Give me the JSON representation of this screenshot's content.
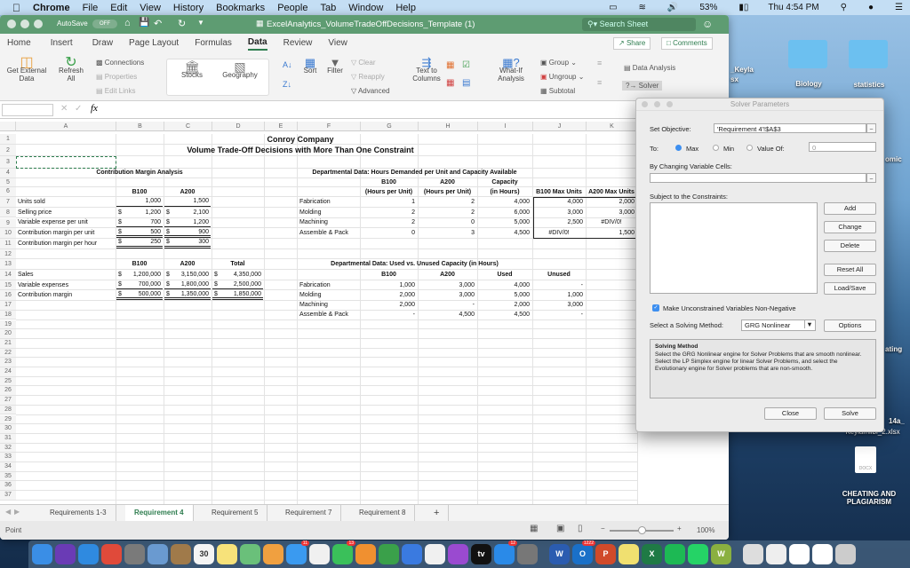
{
  "menubar": {
    "apple": "",
    "app": "Chrome",
    "items": [
      "File",
      "Edit",
      "View",
      "History",
      "Bookmarks",
      "People",
      "Tab",
      "Window",
      "Help"
    ],
    "battery": "53%",
    "clock": "Thu 4:54 PM"
  },
  "excel": {
    "autosave": "AutoSave",
    "autosave_state": "OFF",
    "title": "ExcelAnalytics_VolumeTradeOffDecisions_Template (1)",
    "search_placeholder": "Search Sheet",
    "tabs": [
      "Home",
      "Insert",
      "Draw",
      "Page Layout",
      "Formulas",
      "Data",
      "Review",
      "View"
    ],
    "active_tab": "Data",
    "share": "Share",
    "comments": "Comments",
    "ribbon": {
      "get_external": "Get External Data",
      "refresh_all": "Refresh All",
      "connections": "Connections",
      "properties": "Properties",
      "edit_links": "Edit Links",
      "stocks": "Stocks",
      "geography": "Geography",
      "sort": "Sort",
      "filter": "Filter",
      "clear": "Clear",
      "reapply": "Reapply",
      "advanced": "Advanced",
      "text_to_columns": "Text to Columns",
      "what_if": "What-If Analysis",
      "group": "Group",
      "ungroup": "Ungroup",
      "subtotal": "Subtotal",
      "data_analysis": "Data Analysis",
      "solver": "Solver"
    },
    "formula_bar": {
      "name_box": "",
      "fx": "fx",
      "formula": ""
    },
    "columns": [
      "A",
      "B",
      "C",
      "D",
      "E",
      "F",
      "G",
      "H",
      "I",
      "J",
      "K"
    ],
    "cells": {
      "1": {
        "A": "Conroy Company"
      },
      "2": {
        "A": "Volume Trade-Off Decisions with More Than One Constraint"
      },
      "4": {
        "A": "Contribution Margin Analysis",
        "F": "Departmental Data: Hours Demanded per Unit and Capacity Available"
      },
      "5": {
        "G": "B100",
        "H": "A200",
        "I": "Capacity"
      },
      "6": {
        "B": "B100",
        "C": "A200",
        "G": "(Hours per Unit)",
        "H": "(Hours per Unit)",
        "I": "(in Hours)",
        "J": "B100 Max Units",
        "K": "A200 Max Units"
      },
      "7": {
        "A": "Units sold",
        "B": "1,000",
        "C": "1,500",
        "F": "Fabrication",
        "G": "1",
        "H": "2",
        "I": "4,000",
        "J": "4,000",
        "K": "2,000"
      },
      "8": {
        "A": "Selling price",
        "B": {
          "sym": "$",
          "v": "1,200"
        },
        "C": {
          "sym": "$",
          "v": "2,100"
        },
        "F": "Molding",
        "G": "2",
        "H": "2",
        "I": "6,000",
        "J": "3,000",
        "K": "3,000"
      },
      "9": {
        "A": "Variable expense per unit",
        "B": {
          "sym": "$",
          "v": "700"
        },
        "C": {
          "sym": "$",
          "v": "1,200"
        },
        "F": "Machining",
        "G": "2",
        "H": "0",
        "I": "5,000",
        "J": "2,500",
        "K": "#DIV/0!"
      },
      "10": {
        "A": "Contribution margin per unit",
        "B": {
          "sym": "$",
          "v": "500"
        },
        "C": {
          "sym": "$",
          "v": "900"
        },
        "F": "Assemble & Pack",
        "G": "0",
        "H": "3",
        "I": "4,500",
        "J": "#DIV/0!",
        "K": "1,500"
      },
      "11": {
        "A": "Contribution margin per hour",
        "B": {
          "sym": "$",
          "v": "250"
        },
        "C": {
          "sym": "$",
          "v": "300"
        }
      },
      "13": {
        "B": "B100",
        "C": "A200",
        "D": "Total",
        "F": "Departmental Data: Used vs. Unused Capacity (in Hours)"
      },
      "14": {
        "A": "Sales",
        "B": {
          "sym": "$",
          "v": "1,200,000"
        },
        "C": {
          "sym": "$",
          "v": "3,150,000"
        },
        "D": {
          "sym": "$",
          "v": "4,350,000"
        },
        "G": "B100",
        "H": "A200",
        "I": "Used",
        "J": "Unused"
      },
      "15": {
        "A": "Variable expenses",
        "B": {
          "sym": "$",
          "v": "700,000"
        },
        "C": {
          "sym": "$",
          "v": "1,800,000"
        },
        "D": {
          "sym": "$",
          "v": "2,500,000"
        },
        "F": "Fabrication",
        "G": "1,000",
        "H": "3,000",
        "I": "4,000",
        "J": "-"
      },
      "16": {
        "A": "Contribution margin",
        "B": {
          "sym": "$",
          "v": "500,000"
        },
        "C": {
          "sym": "$",
          "v": "1,350,000"
        },
        "D": {
          "sym": "$",
          "v": "1,850,000"
        },
        "F": "Molding",
        "G": "2,000",
        "H": "3,000",
        "I": "5,000",
        "J": "1,000"
      },
      "17": {
        "F": "Machining",
        "G": "2,000",
        "H": "-",
        "I": "2,000",
        "J": "3,000"
      },
      "18": {
        "F": "Assemble & Pack",
        "G": "-",
        "H": "4,500",
        "I": "4,500",
        "J": "-"
      }
    },
    "sheet_tabs": [
      "Requirements 1-3",
      "Requirement 4",
      "Requirement 5",
      "Requirement 7",
      "Requirement 8"
    ],
    "active_sheet": "Requirement 4",
    "add_sheet": "+",
    "status": {
      "mode": "Point",
      "zoom": "100%",
      "zoom_level": 100
    }
  },
  "solver": {
    "title": "Solver Parameters",
    "set_objective_label": "Set Objective:",
    "set_objective": "'Requirement 4'!$A$3",
    "to_label": "To:",
    "max": "Max",
    "min": "Min",
    "value_of": "Value Of:",
    "value": "0",
    "selected": "Max",
    "changing_label": "By Changing Variable Cells:",
    "changing": "",
    "constraints_label": "Subject to the Constraints:",
    "buttons": {
      "add": "Add",
      "change": "Change",
      "delete": "Delete",
      "reset": "Reset All",
      "load": "Load/Save",
      "options": "Options",
      "close": "Close",
      "solve": "Solve"
    },
    "nonneg_label": "Make Unconstrained Variables Non-Negative",
    "nonneg_checked": true,
    "method_label": "Select a Solving Method:",
    "method": "GRG Nonlinear",
    "method_title": "Solving Method",
    "method_desc": "Select the GRG Nonlinear engine for Solver Problems that are smooth nonlinear. Select the LP Simplex engine for linear Solver Problems, and select the Evolutionary engine for Solver problems that are non-smooth."
  },
  "desktop": {
    "items": [
      "_Keyla",
      "sx",
      "Biology",
      "statistics",
      "omic",
      "ating",
      "14a_",
      "Keylamilbl_2.xlsx",
      "DOCX",
      "CHEATING AND PLAGIARISM"
    ]
  },
  "dock": {
    "apps": [
      {
        "name": "finder",
        "color": "#3a8ee6"
      },
      {
        "name": "siri",
        "color": "#6a3bb5"
      },
      {
        "name": "safari",
        "color": "#2f8ae0"
      },
      {
        "name": "chrome",
        "color": "#e04a3a"
      },
      {
        "name": "launchpad",
        "color": "#7a7a7a"
      },
      {
        "name": "preview",
        "color": "#6a9ad0"
      },
      {
        "name": "contacts",
        "color": "#a07a4a"
      },
      {
        "name": "calendar",
        "color": "#f4f4f4",
        "label": "30"
      },
      {
        "name": "notes",
        "color": "#f7e27a"
      },
      {
        "name": "maps",
        "color": "#6ac07a"
      },
      {
        "name": "photos",
        "color": "#f0a040"
      },
      {
        "name": "messages",
        "color": "#3a9af0",
        "badge": "11"
      },
      {
        "name": "news",
        "color": "#f0f0f0"
      },
      {
        "name": "facetime",
        "color": "#3ac05a",
        "badge": "13"
      },
      {
        "name": "pages",
        "color": "#f09030"
      },
      {
        "name": "numbers",
        "color": "#3aa04a"
      },
      {
        "name": "keynote",
        "color": "#3a7ae0"
      },
      {
        "name": "itunes",
        "color": "#f0f0f0"
      },
      {
        "name": "podcasts",
        "color": "#9a4ad0"
      },
      {
        "name": "tv",
        "color": "#111",
        "label": "tv"
      },
      {
        "name": "app-store",
        "color": "#2a8ae8",
        "badge": "12"
      },
      {
        "name": "system-preferences",
        "color": "#777"
      },
      {
        "name": "word",
        "color": "#2b5cb0",
        "label": "W"
      },
      {
        "name": "outlook",
        "color": "#1a70c8",
        "label": "O",
        "badge": "1222"
      },
      {
        "name": "powerpoint",
        "color": "#d04a2a",
        "label": "P"
      },
      {
        "name": "stickies",
        "color": "#f0e070"
      },
      {
        "name": "excel",
        "color": "#1f7a45",
        "label": "X"
      },
      {
        "name": "spotify",
        "color": "#1db954"
      },
      {
        "name": "whatsapp",
        "color": "#25d366"
      },
      {
        "name": "w-app",
        "color": "#8ab040",
        "label": "W"
      },
      {
        "name": "window-1",
        "color": "#ddd"
      },
      {
        "name": "window-2",
        "color": "#eee"
      },
      {
        "name": "window-3",
        "color": "#fff"
      },
      {
        "name": "window-4",
        "color": "#fff"
      },
      {
        "name": "trash",
        "color": "#ccc"
      }
    ]
  }
}
